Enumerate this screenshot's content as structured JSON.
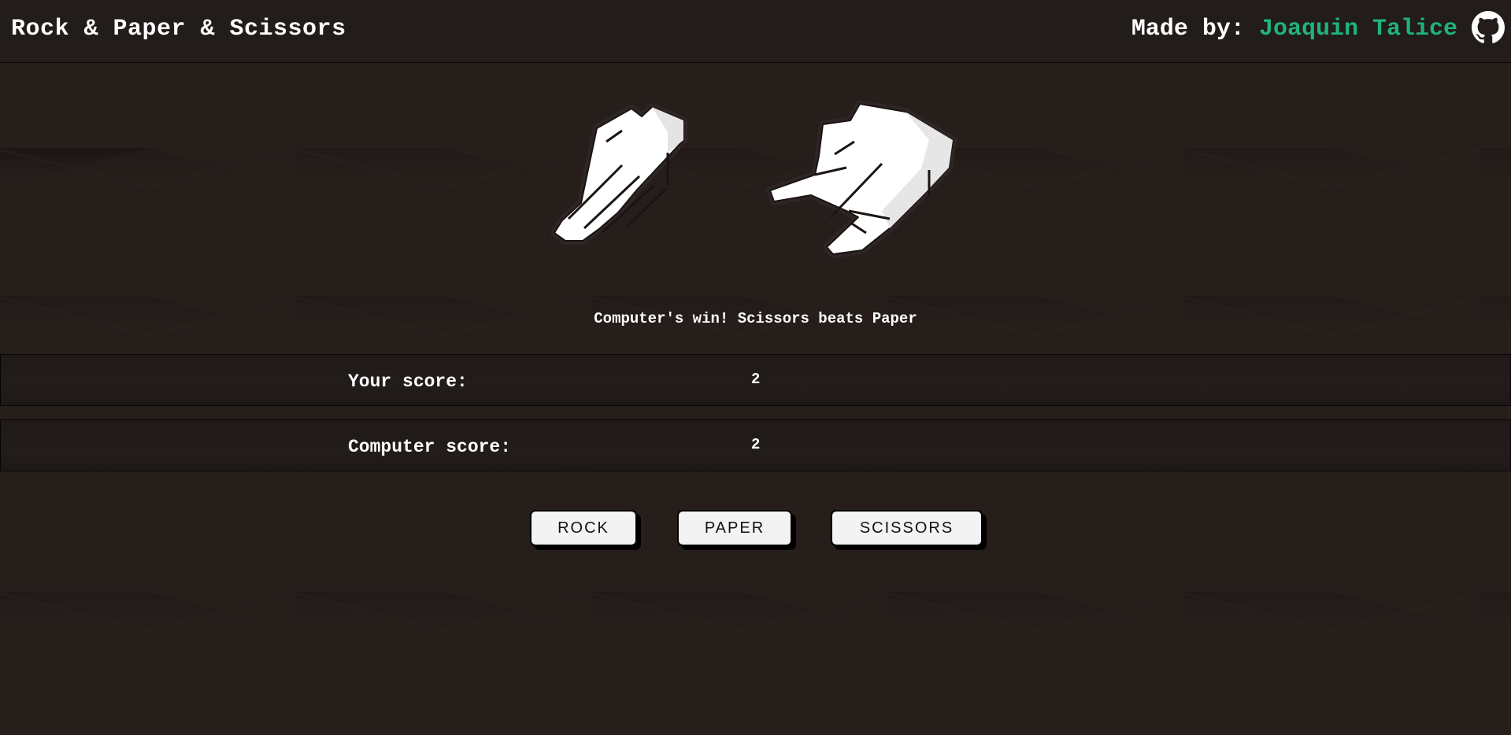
{
  "header": {
    "title": "Rock & Paper & Scissors",
    "made_by_label": "Made by:",
    "author": "Joaquin Talice",
    "github_icon": "github-icon"
  },
  "colors": {
    "background": "#261e1b",
    "header": "#221c1a",
    "author_accent": "#1fb37f",
    "button": "#f3f3f3"
  },
  "game": {
    "player_hand_icon": "paper-hand-icon",
    "computer_hand_icon": "scissors-hand-icon",
    "result_message": "Computer's win! Scissors beats Paper"
  },
  "scores": {
    "player_label": "Your score:",
    "player_value": "2",
    "computer_label": "Computer score:",
    "computer_value": "2"
  },
  "buttons": {
    "rock": "ROCK",
    "paper": "PAPER",
    "scissors": "SCISSORS"
  }
}
